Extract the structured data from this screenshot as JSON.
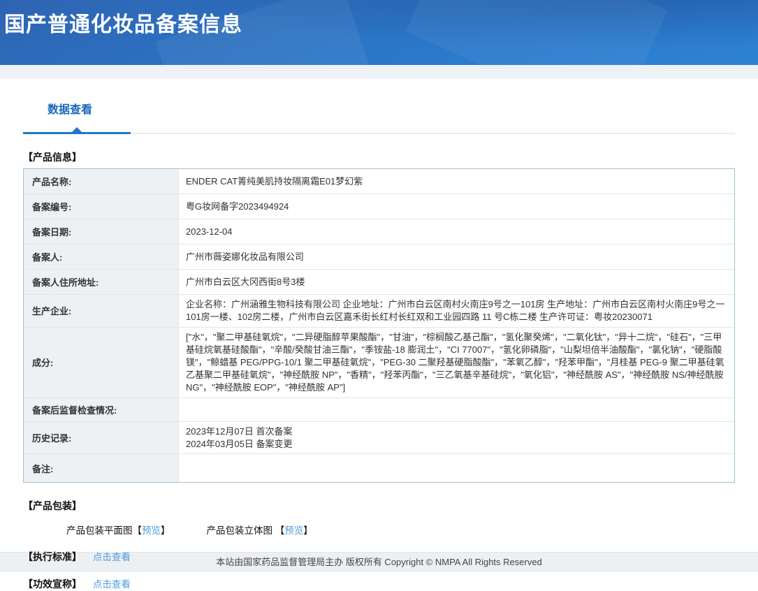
{
  "header": {
    "title": "国产普通化妆品备案信息"
  },
  "tabs": {
    "data_view": "数据查看"
  },
  "product_info": {
    "section_title": "【产品信息】",
    "rows": [
      {
        "label": "产品名称:",
        "value": "ENDER CAT箐纯美肌持妆隔离霜E01梦幻紫"
      },
      {
        "label": "备案编号:",
        "value": "粤G妆网备字2023494924"
      },
      {
        "label": "备案日期:",
        "value": "2023-12-04"
      },
      {
        "label": "备案人:",
        "value": "广州市薇姿娜化妆品有限公司"
      },
      {
        "label": "备案人住所地址:",
        "value": "广州市白云区大冈西街8号3楼"
      },
      {
        "label": "生产企业:",
        "value": "企业名称：广州涵雅生物科技有限公司 企业地址：广州市白云区南村火南庄9号之一101房 生产地址：广州市白云区南村火南庄9号之一101房一楼、102房二楼，广州市白云区嘉禾街长红村长红双和工业园四路 11 号C栋二楼 生产许可证：粤妆20230071"
      },
      {
        "label": "成分:",
        "value": "[\"水\"，\"聚二甲基硅氧烷\"，\"二异硬脂醇苹果酸酯\"，\"甘油\"，\"棕榈酸乙基己酯\"，\"氢化聚癸烯\"，\"二氧化钛\"，\"异十二烷\"，\"硅石\"，\"三甲基硅烷氧基硅酸酯\"，\"辛酸/癸酸甘油三酯\"，\"季铵盐-18 膨润土\"，\"CI 77007\"，\"氢化卵磷脂\"，\"山梨坦倍半油酸酯\"，\"氯化钠\"，\"硬脂酸镁\"，\"鲸蜡基 PEG/PPG-10/1 聚二甲基硅氧烷\"，\"PEG-30 二聚羟基硬脂酸酯\"，\"苯氧乙醇\"，\"羟苯甲酯\"，\"月桂基 PEG-9 聚二甲基硅氧乙基聚二甲基硅氧烷\"，\"神经酰胺 NP\"，\"香精\"，\"羟苯丙酯\"，\"三乙氧基辛基硅烷\"，\"氧化铝\"，\"神经酰胺 AS\"，\"神经酰胺 NS/神经酰胺 NG\"，\"神经酰胺 EOP\"，\"神经酰胺 AP\"]"
      },
      {
        "label": "备案后监督检查情况:",
        "value": ""
      },
      {
        "label": "历史记录:",
        "lines": [
          "2023年12月07日 首次备案",
          "2024年03月05日 备案变更"
        ]
      },
      {
        "label": "备注:",
        "value": ""
      }
    ]
  },
  "packaging": {
    "section_title": "【产品包装】",
    "flat_label": "产品包装平面图",
    "stereo_label": "产品包装立体图",
    "bracket_open": "【",
    "bracket_close": "】",
    "preview_link": "预览"
  },
  "standard": {
    "section_title": "【执行标准】",
    "link": "点击查看"
  },
  "efficacy": {
    "section_title": "【功效宣称】",
    "link": "点击查看"
  },
  "footer": {
    "copyright": "本站由国家药品监督管理局主办 版权所有 Copyright © NMPA All Rights Reserved"
  },
  "colors": {
    "header_gradient_start": "#2e64b2",
    "header_gradient_end": "#2e82d4",
    "tab_active": "#2175c8",
    "link_blue": "#4f9ce0",
    "table_outer_border": "#a6bfd1",
    "table_inner_border": "#e1e6ea",
    "label_cell_bg": "#eef1f4",
    "page_band_bg": "#eef2f5"
  }
}
